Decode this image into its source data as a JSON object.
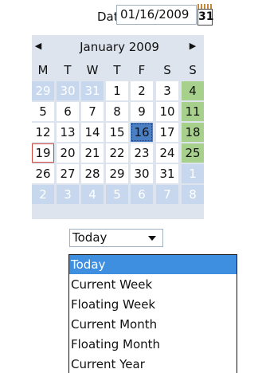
{
  "date_field": {
    "label": "Date",
    "value": "01/16/2009"
  },
  "calendar_button": {
    "icon": "calendar-icon",
    "number": "31"
  },
  "calendar": {
    "month_label": "January 2009",
    "prev_icon": "◀",
    "next_icon": "▶",
    "weekdays": [
      "M",
      "T",
      "W",
      "T",
      "F",
      "S",
      "S"
    ],
    "weeks": [
      [
        "29",
        "30",
        "31",
        "1",
        "2",
        "3",
        "4"
      ],
      [
        "5",
        "6",
        "7",
        "8",
        "9",
        "10",
        "11"
      ],
      [
        "12",
        "13",
        "14",
        "15",
        "16",
        "17",
        "18"
      ],
      [
        "19",
        "20",
        "21",
        "22",
        "23",
        "24",
        "25"
      ],
      [
        "26",
        "27",
        "28",
        "29",
        "30",
        "31",
        "1"
      ],
      [
        "2",
        "3",
        "4",
        "5",
        "6",
        "7",
        "8"
      ]
    ],
    "selected_day": "16",
    "today_day": "19"
  },
  "range_select": {
    "value": "Today",
    "options": [
      "Today",
      "Current Week",
      "Floating Week",
      "Current Month",
      "Floating Month",
      "Current Year"
    ]
  },
  "colors": {
    "weekend_highlight": "#a8d08d",
    "selected": "#4a7fc4",
    "outside_month": "#c6d7ee",
    "today_border": "#d0443a",
    "dropdown_active": "#3f8fe0"
  }
}
